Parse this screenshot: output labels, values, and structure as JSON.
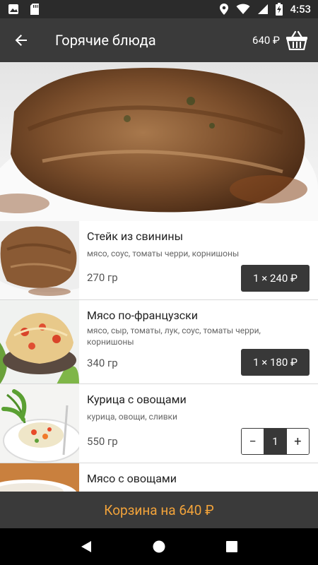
{
  "status_bar": {
    "time": "4:53",
    "icons": [
      "photo-notification-icon",
      "sd-card-icon",
      "location-icon",
      "wifi-icon",
      "signal-icon",
      "battery-charging-icon"
    ]
  },
  "app_bar": {
    "title": "Горячие блюда",
    "cart_total": "640 ₽",
    "back_icon": "arrow-back-icon",
    "cart_icon": "basket-icon"
  },
  "dishes": [
    {
      "name": "Стейк из свинины",
      "ingredients": "мясо, соус, томаты черри, корнишоны",
      "weight": "270 гр",
      "price_label": "1 × 240 ₽"
    },
    {
      "name": "Мясо по-французски",
      "ingredients": "мясо, сыр, томаты, лук, соус, томаты черри, корнишоны",
      "weight": "340 гр",
      "price_label": "1 × 180 ₽"
    },
    {
      "name": "Курица с овощами",
      "ingredients": "курица, овощи, сливки",
      "weight": "550 гр",
      "stepper": {
        "minus": "−",
        "value": "1",
        "plus": "+"
      }
    },
    {
      "name": "Мясо с овощами"
    }
  ],
  "cart_button": "Корзина на 640 ₽",
  "colors": {
    "app_bar": "#3a3a3a",
    "accent": "#f2a33a",
    "button": "#383838"
  }
}
